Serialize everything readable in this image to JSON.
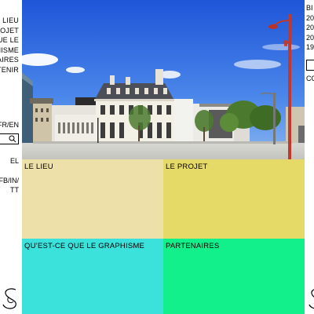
{
  "sidebar_left": {
    "nav": [
      "E LIEU",
      "ROJET",
      "UE LE",
      "HISME",
      "AIRES",
      "TENIR"
    ],
    "lang": "FR/EN",
    "newsletter": "EL",
    "social": [
      "FB/IN/",
      "TT"
    ]
  },
  "sidebar_right": {
    "hours": [
      "BI",
      "20",
      "20",
      "20",
      "19"
    ],
    "cont": "CO"
  },
  "tiles": {
    "lieu": "LE LIEU",
    "projet": "LE PROJET",
    "graphisme": "QU’EST-CE QUE LE GRAPHISME",
    "partenaires": "PARTENAIRES"
  },
  "colors": {
    "lieu": "#ede0a9",
    "projet": "#e5da68",
    "graphisme": "#3be2dc",
    "partenaires": "#12f08b"
  }
}
